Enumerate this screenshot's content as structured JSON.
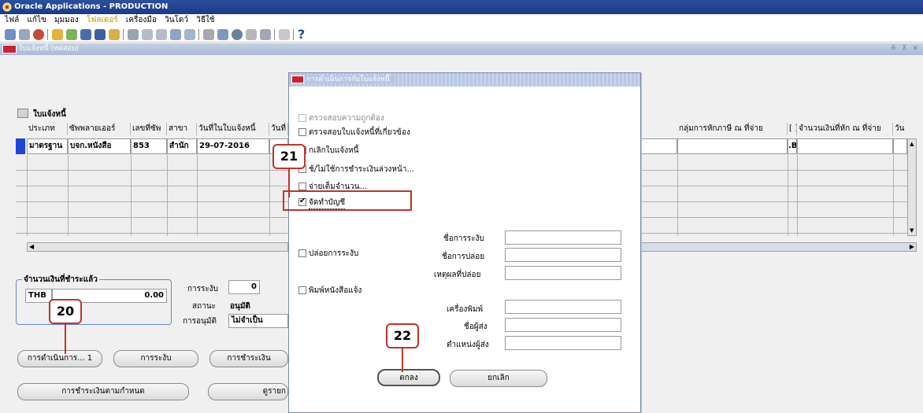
{
  "window": {
    "title": "Oracle Applications - PRODUCTION"
  },
  "menu": {
    "items": [
      "ไฟล์",
      "แก้ไข",
      "มุมมอง",
      "โฟลเดอร์",
      "เครื่องมือ",
      "วินโดว์",
      "วิธีใช้"
    ],
    "highlighted_index": 3
  },
  "subwindow": {
    "title": "ใบแจ้งหนี้ (ทดสอบ)",
    "controls": "≚ ⊼ ✕"
  },
  "invoice_block": {
    "title": "ใบแจ้งหนี้",
    "columns_left": [
      "ประเภท",
      "ซัพพลายเออร์",
      "เลขที่ซัพ",
      "สาขา",
      "วันที่ในใบแจ้งหนี้",
      "วันที่"
    ],
    "columns_right": [
      "กลุ่มการหักภาษี ณ ที่จ่าย",
      "[ ]",
      "จำนวนเงินที่หัก ณ ที่จ่าย",
      "วัน"
    ],
    "row1": {
      "type": "มาตรฐาน",
      "supplier": "บจก.หนังสือ",
      "supplier_no": "853",
      "branch": "สำนัก",
      "invoice_date": "29-07-2016",
      "right_value": ".Bl"
    }
  },
  "amount_paid": {
    "title": "จำนวนเงินที่ชำระแล้ว",
    "currency": "THB",
    "amount": "0.00"
  },
  "status_panel": {
    "hold_label": "การระงับ",
    "hold_value": "0",
    "status_label": "สถานะ",
    "status_value": "อนุมัติ",
    "approval_label": "การอนุมัติ",
    "approval_value": "ไม่จำเป็น"
  },
  "buttons": {
    "actions": "การดำเนินการ... 1",
    "holds": "การระงับ",
    "payments": "การชำระเงิน",
    "scheduled_payments": "การชำระเงินตามกำหนด",
    "view": "ดูรายก"
  },
  "dialog": {
    "title": "การดำเนินการกับใบแจ้งหนี้",
    "options": [
      {
        "label": "ตรวจสอบความถูกต้อง",
        "checked": false,
        "disabled": true
      },
      {
        "label": "ตรวจสอบใบแจ้งหนี้ที่เกี่ยวข้อง",
        "checked": false,
        "disabled": false
      },
      {
        "label": "กเลิกใบแจ้งหนี้",
        "checked": false,
        "disabled": false
      },
      {
        "label": "ช้/ไม่ใช้การชำระเงินล่วงหน้า...",
        "checked": false,
        "disabled": false
      },
      {
        "label": "จ่ายเต็มจำนวน...",
        "checked": false,
        "disabled": false
      },
      {
        "label": "จัดทำบัญชี",
        "checked": true,
        "disabled": false
      }
    ],
    "release_hold": {
      "label": "ปล่อยการระงับ",
      "hold_name_label": "ชื่อการระงับ",
      "release_name_label": "ชื่อการปล่อย",
      "release_reason_label": "เหตุผลที่ปล่อย"
    },
    "print_notice": {
      "label": "พิมพ์หนังสือแจ้ง",
      "printer_label": "เครื่องพิมพ์",
      "sender_name_label": "ชื่อผู้ส่ง",
      "sender_title_label": "ตำแหน่งผู้ส่ง"
    },
    "ok": "ตกลง",
    "cancel": "ยกเลิก"
  },
  "callouts": {
    "c20": "20",
    "c21": "21",
    "c22": "22"
  },
  "colors": {
    "accent_red": "#c0342a",
    "title_blue": "#1a3a86"
  }
}
